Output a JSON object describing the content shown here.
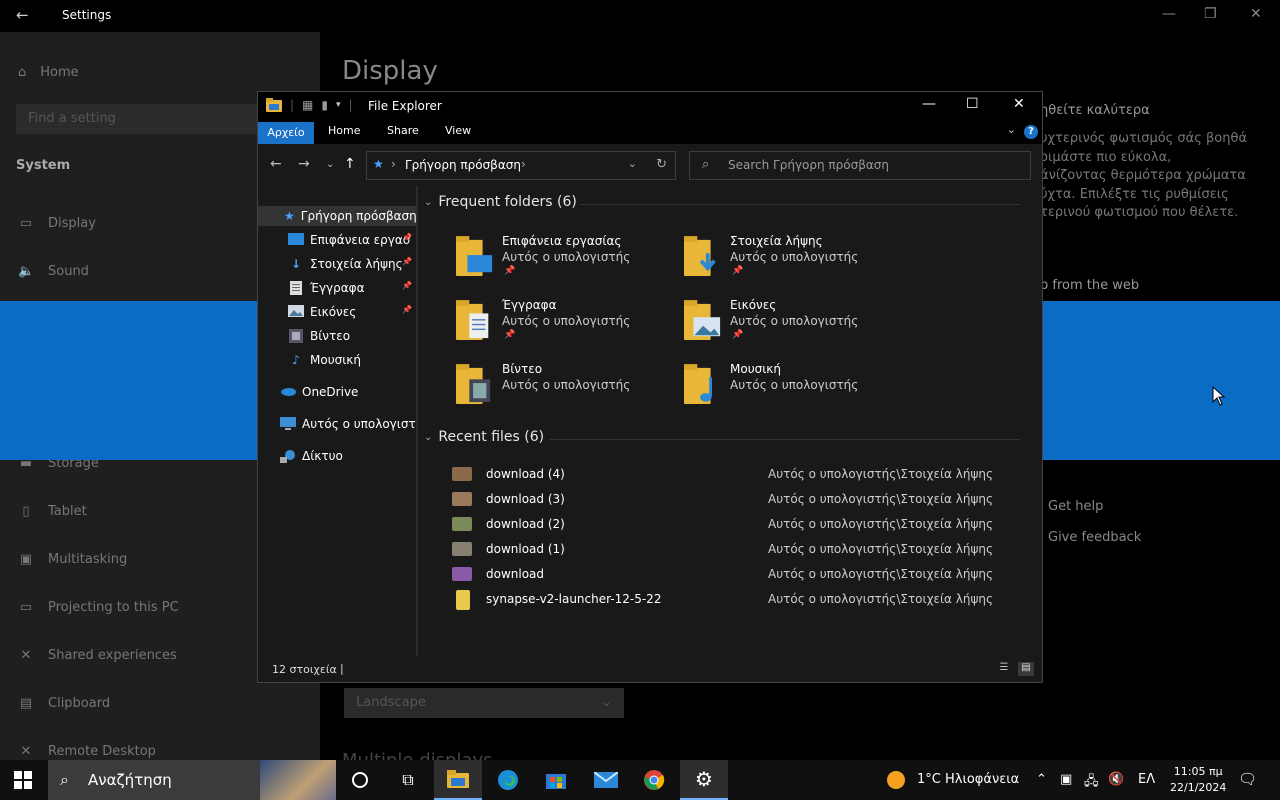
{
  "settings": {
    "title": "Settings",
    "home": "Home",
    "find_placeholder": "Find a setting",
    "section": "System",
    "nav": [
      {
        "label": "Display",
        "icon": "monitor-icon",
        "glyph": "▭"
      },
      {
        "label": "Sound",
        "icon": "speaker-icon",
        "glyph": "🔈"
      },
      {
        "label": "Storage",
        "icon": "storage-icon",
        "glyph": "▬"
      },
      {
        "label": "Tablet",
        "icon": "tablet-icon",
        "glyph": "▯"
      },
      {
        "label": "Multitasking",
        "icon": "multitasking-icon",
        "glyph": "▣"
      },
      {
        "label": "Projecting to this PC",
        "icon": "projecting-icon",
        "glyph": "▭"
      },
      {
        "label": "Shared experiences",
        "icon": "shared-icon",
        "glyph": "✕"
      },
      {
        "label": "Clipboard",
        "icon": "clipboard-icon",
        "glyph": "▤"
      },
      {
        "label": "Remote Desktop",
        "icon": "remote-icon",
        "glyph": "✕"
      }
    ],
    "page_title": "Display",
    "right_heading": "ηθείτε καλύτερα",
    "right_para": [
      "υχτερινός φωτισμός σάς βοηθά",
      "οιμάστε πιο εύκολα,",
      "άνίζοντας θερμότερα χρώματα",
      "ύχτα. Επιλέξτε τις ρυθμίσεις",
      "τερινού φωτισμού που θέλετε."
    ],
    "web_text": "p from the web",
    "get_help": "Get help",
    "give_feedback": "Give feedback",
    "orientation_value": "Landscape",
    "multi_partial": "Multiple displays"
  },
  "explorer": {
    "title": "File Explorer",
    "tabs": {
      "file": "Αρχείο",
      "home": "Home",
      "share": "Share",
      "view": "View"
    },
    "address": "Γρήγορη πρόσβαση",
    "search_placeholder": "Search Γρήγορη πρόσβαση",
    "navpane": [
      {
        "label": "Γρήγορη πρόσβαση",
        "icon": "star-icon",
        "pinned": false
      },
      {
        "label": "Επιφάνεια εργασ",
        "icon": "desktop-icon",
        "pinned": true
      },
      {
        "label": "Στοιχεία λήψης",
        "icon": "downloads-icon",
        "pinned": true
      },
      {
        "label": "Έγγραφα",
        "icon": "documents-icon",
        "pinned": true
      },
      {
        "label": "Εικόνες",
        "icon": "pictures-icon",
        "pinned": true
      },
      {
        "label": "Βίντεο",
        "icon": "videos-icon",
        "pinned": false
      },
      {
        "label": "Μουσική",
        "icon": "music-icon",
        "pinned": false
      },
      {
        "label": "OneDrive",
        "icon": "onedrive-icon",
        "pinned": false
      },
      {
        "label": "Αυτός ο υπολογιστή",
        "icon": "this-pc-icon",
        "pinned": false
      },
      {
        "label": "Δίκτυο",
        "icon": "network-icon",
        "pinned": false
      }
    ],
    "frequent_title": "Frequent folders (6)",
    "frequent": [
      {
        "name": "Επιφάνεια εργασίας",
        "location": "Αυτός ο υπολογιστής",
        "pinned": true,
        "overlay": "desktop"
      },
      {
        "name": "Στοιχεία λήψης",
        "location": "Αυτός ο υπολογιστής",
        "pinned": true,
        "overlay": "download"
      },
      {
        "name": "Έγγραφα",
        "location": "Αυτός ο υπολογιστής",
        "pinned": true,
        "overlay": "document"
      },
      {
        "name": "Εικόνες",
        "location": "Αυτός ο υπολογιστής",
        "pinned": true,
        "overlay": "picture"
      },
      {
        "name": "Βίντεο",
        "location": "Αυτός ο υπολογιστής",
        "pinned": false,
        "overlay": "video"
      },
      {
        "name": "Μουσική",
        "location": "Αυτός ο υπολογιστής",
        "pinned": false,
        "overlay": "music"
      }
    ],
    "recent_title": "Recent files (6)",
    "recent": [
      {
        "name": "download (4)",
        "path": "Αυτός ο υπολογιστής\\Στοιχεία λήψης",
        "thumb": "#8a6a4a"
      },
      {
        "name": "download (3)",
        "path": "Αυτός ο υπολογιστής\\Στοιχεία λήψης",
        "thumb": "#9a7a5a"
      },
      {
        "name": "download (2)",
        "path": "Αυτός ο υπολογιστής\\Στοιχεία λήψης",
        "thumb": "#7a8a5a"
      },
      {
        "name": "download (1)",
        "path": "Αυτός ο υπολογιστής\\Στοιχεία λήψης",
        "thumb": "#888070"
      },
      {
        "name": "download",
        "path": "Αυτός ο υπολογιστής\\Στοιχεία λήψης",
        "thumb": "#8a5aa8"
      },
      {
        "name": "synapse-v2-launcher-12-5-22",
        "path": "Αυτός ο υπολογιστής\\Στοιχεία λήψης",
        "thumb": "#e8c84a"
      }
    ],
    "status_count": "12 στοιχεία"
  },
  "taskbar": {
    "search_text": "Αναζήτηση",
    "weather": "1°C  Ηλιοφάνεια",
    "lang": "ΕΛ",
    "time": "11:05 πμ",
    "date": "22/1/2024"
  }
}
